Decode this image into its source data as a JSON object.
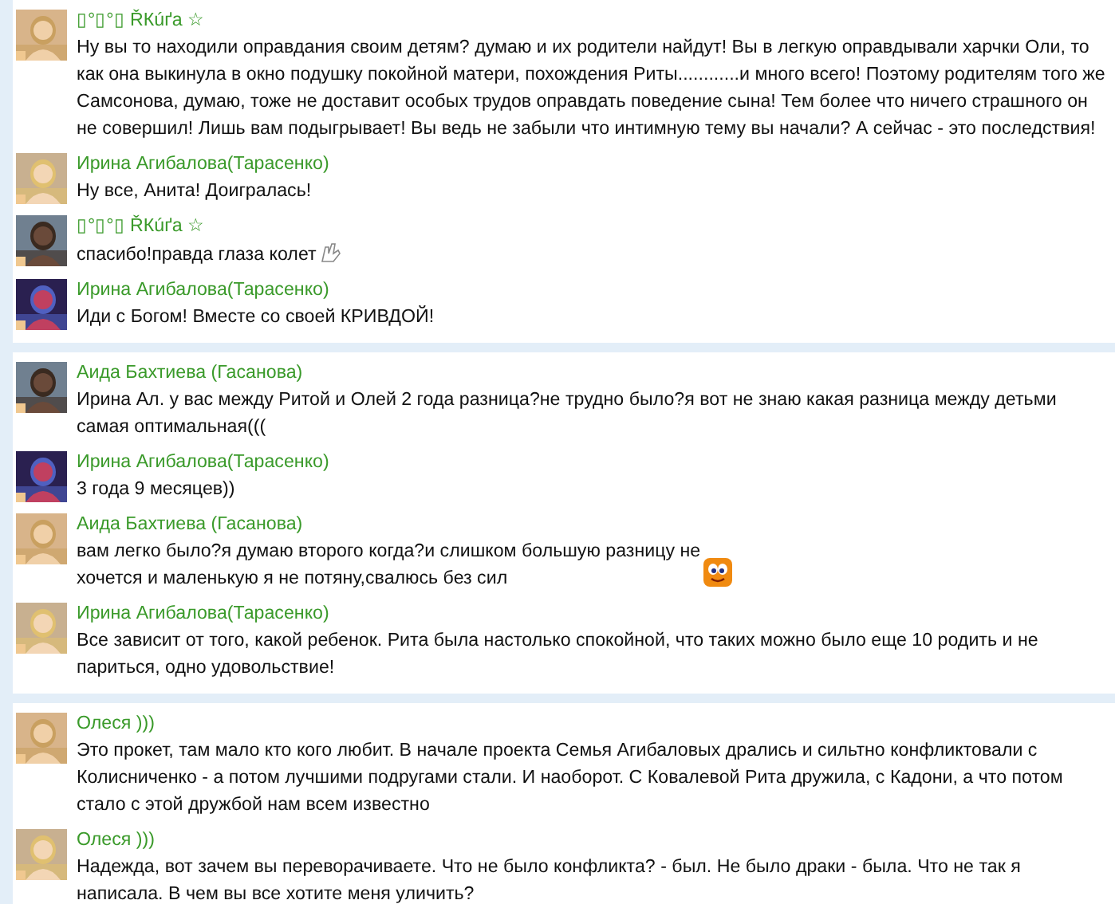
{
  "panels": [
    {
      "comments": [
        {
          "author": "▯°▯°▯ ŘКúґа ☆",
          "text": "Ну вы то находили оправдания своим детям? думаю и их родители найдут! Вы в легкую оправдывали харчки Оли, то как она выкинула в окно подушку покойной матери, похождения Риты............и много всего! Поэтому родителям того же Самсонова, думаю, тоже не доставит особых трудов оправдать поведение сына! Тем более что ничего страшного он не совершил! Лишь вам подыгрывает! Вы ведь не забыли что интимную тему вы начали? А сейчас - это последствия!"
        },
        {
          "author": "Ирина Агибалова(Тарасенко)",
          "text": "Ну все, Анита! Доигралась!"
        },
        {
          "author": "▯°▯°▯ ŘКúґа ☆",
          "text": "спасибо!правда глаза колет",
          "kind": "hand"
        },
        {
          "author": "Ирина Агибалова(Тарасенко)",
          "text": "Иди с Богом! Вместе со своей КРИВДОЙ!"
        }
      ]
    },
    {
      "comments": [
        {
          "author": "Аида Бахтиева (Гасанова)",
          "text": "Ирина Ал. у вас между Ритой и Олей 2 года разница?не трудно было?я вот не знаю какая разница между детьми самая оптимальная((("
        },
        {
          "author": "Ирина Агибалова(Тарасенко)",
          "text": "3 года 9 месяцев))"
        },
        {
          "author": "Аида Бахтиева (Гасанова)",
          "text": "вам легко было?я думаю второго когда?и слишком большую разницу не\nхочется и маленькую я не потяну,свалюсь без сил",
          "kind": "smiley"
        },
        {
          "author": "Ирина Агибалова(Тарасенко)",
          "text": "Все зависит от того, какой ребенок. Рита была настолько спокойной, что таких можно было еще 10 родить и не париться, одно удовольствие!"
        }
      ]
    },
    {
      "comments": [
        {
          "author": "Олеся )))",
          "text": "Это прокет, там мало кто кого любит. В начале проекта Семья Агибаловых дрались и сильтно конфликтовали с Колисниченко - а потом лучшими подругами стали. И наоборот. С Ковалевой Рита дружила, с Кадони, а что потом стало  с этой дружбой нам всем известно"
        },
        {
          "author": "Олеся )))",
          "text": "Надежда, вот зачем вы переворачиваете. Что не было конфликта? - был. Не было драки - была. Что не так я написала. В чем вы все хотите меня уличить?"
        }
      ]
    }
  ]
}
